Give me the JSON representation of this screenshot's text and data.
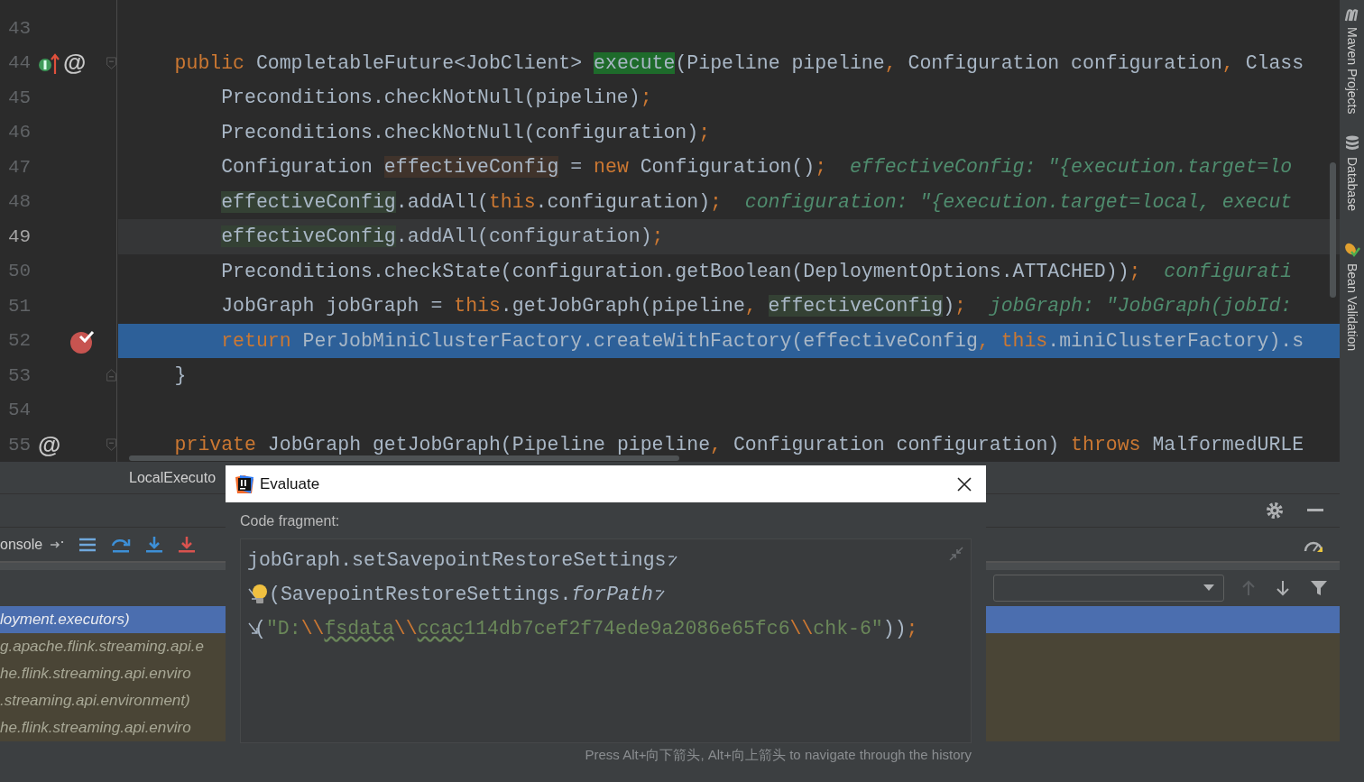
{
  "editor": {
    "lines": [
      {
        "number": "43",
        "caret_line": false,
        "execution_point": false
      },
      {
        "number": "44",
        "kind": "declaration",
        "caret_line": false,
        "execution_point": false,
        "marks": [
          {
            "kind": "implementing"
          },
          {
            "kind": "annotation",
            "text": "@"
          },
          {
            "kind": "fold-start"
          }
        ],
        "tokens": [
          {
            "text": "public",
            "kind": "keyword"
          },
          {
            "text": " CompletableFuture<JobClient> ",
            "kind": "plain"
          },
          {
            "text": "execute",
            "kind": "decl"
          },
          {
            "text": "(Pipeline pipeline",
            "kind": "plain"
          },
          {
            "text": ", ",
            "kind": "punct"
          },
          {
            "text": "Configuration configuration",
            "kind": "plain"
          },
          {
            "text": ", ",
            "kind": "punct"
          },
          {
            "text": "Class",
            "kind": "plain"
          }
        ]
      },
      {
        "number": "45",
        "kind": "statement",
        "caret_line": false,
        "execution_point": false,
        "tokens": [
          {
            "text": "Preconditions.checkNotNull(pipeline)",
            "kind": "plain"
          },
          {
            "text": ";",
            "kind": "punct"
          }
        ]
      },
      {
        "number": "46",
        "kind": "statement",
        "caret_line": false,
        "execution_point": false,
        "tokens": [
          {
            "text": "Preconditions.checkNotNull(configuration)",
            "kind": "plain"
          },
          {
            "text": ";",
            "kind": "punct"
          }
        ]
      },
      {
        "number": "47",
        "kind": "statement",
        "caret_line": false,
        "execution_point": false,
        "tokens": [
          {
            "text": "Configuration ",
            "kind": "plain"
          },
          {
            "text": "effectiveConfig",
            "kind": "write"
          },
          {
            "text": " = ",
            "kind": "plain"
          },
          {
            "text": "new",
            "kind": "keyword"
          },
          {
            "text": " Configuration()",
            "kind": "plain"
          },
          {
            "text": ";",
            "kind": "punct"
          },
          {
            "text": "  effectiveConfig: \"{execution.target=lo",
            "kind": "hint"
          }
        ]
      },
      {
        "number": "48",
        "kind": "statement",
        "caret_line": false,
        "execution_point": false,
        "tokens": [
          {
            "text": "effectiveConfig",
            "kind": "read"
          },
          {
            "text": ".addAll(",
            "kind": "plain"
          },
          {
            "text": "this",
            "kind": "keyword"
          },
          {
            "text": ".configuration)",
            "kind": "plain"
          },
          {
            "text": ";",
            "kind": "punct"
          },
          {
            "text": "  configuration: \"{execution.target=local, execut",
            "kind": "hint"
          }
        ]
      },
      {
        "number": "49",
        "kind": "statement",
        "caret_line": true,
        "execution_point": false,
        "tokens": [
          {
            "text": "effectiveConfig",
            "kind": "read"
          },
          {
            "text": ".addAll(configuration)",
            "kind": "plain"
          },
          {
            "text": ";",
            "kind": "punct"
          }
        ]
      },
      {
        "number": "50",
        "kind": "statement",
        "caret_line": false,
        "execution_point": false,
        "tokens": [
          {
            "text": "Preconditions.checkState(configuration.getBoolean(DeploymentOptions.ATTACHED))",
            "kind": "plain"
          },
          {
            "text": ";",
            "kind": "punct"
          },
          {
            "text": "  configurati",
            "kind": "hint"
          }
        ]
      },
      {
        "number": "51",
        "kind": "statement",
        "caret_line": false,
        "execution_point": false,
        "tokens": [
          {
            "text": "JobGraph jobGraph = ",
            "kind": "plain"
          },
          {
            "text": "this",
            "kind": "keyword"
          },
          {
            "text": ".getJobGraph(pipeline",
            "kind": "plain"
          },
          {
            "text": ", ",
            "kind": "punct"
          },
          {
            "text": "effectiveConfig",
            "kind": "read"
          },
          {
            "text": ")",
            "kind": "plain"
          },
          {
            "text": ";",
            "kind": "punct"
          },
          {
            "text": "  jobGraph: \"JobGraph(jobId:",
            "kind": "hint"
          }
        ]
      },
      {
        "number": "52",
        "kind": "statement",
        "caret_line": false,
        "execution_point": true,
        "marks": [
          {
            "kind": "breakpoint"
          }
        ],
        "tokens": [
          {
            "text": "return",
            "kind": "keyword"
          },
          {
            "text": " PerJobMiniClusterFactory.createWithFactory(effectiveConfig",
            "kind": "plain"
          },
          {
            "text": ", ",
            "kind": "punct"
          },
          {
            "text": "this",
            "kind": "keyword"
          },
          {
            "text": ".miniClusterFactory).s",
            "kind": "plain"
          }
        ]
      },
      {
        "number": "53",
        "kind": "closing",
        "caret_line": false,
        "execution_point": false,
        "marks": [
          {
            "kind": "fold-end"
          }
        ],
        "tokens": [
          {
            "text": "}",
            "kind": "plain"
          }
        ]
      },
      {
        "number": "54",
        "caret_line": false,
        "execution_point": false
      },
      {
        "number": "55",
        "kind": "declaration",
        "caret_line": false,
        "execution_point": false,
        "marks": [
          {
            "kind": "annotation",
            "text": "@"
          },
          {
            "kind": "fold-start"
          }
        ],
        "tokens": [
          {
            "text": "private",
            "kind": "keyword"
          },
          {
            "text": " JobGraph getJobGraph(Pipeline pipeline",
            "kind": "plain"
          },
          {
            "text": ", ",
            "kind": "punct"
          },
          {
            "text": "Configuration configuration) ",
            "kind": "plain"
          },
          {
            "text": "throws",
            "kind": "keyword"
          },
          {
            "text": " MalformedURLE",
            "kind": "plain"
          }
        ]
      }
    ]
  },
  "bottom_panel": {
    "tab": "LocalExecuto",
    "console_tab": "onsole",
    "frames": [
      {
        "text": "loyment.executors)",
        "selected": true
      },
      {
        "text": "g.apache.flink.streaming.api.e",
        "selected": false
      },
      {
        "text": "he.flink.streaming.api.enviro",
        "selected": false
      },
      {
        "text": ".streaming.api.environment)",
        "selected": false
      },
      {
        "text": "he.flink.streaming.api.enviro",
        "selected": false
      }
    ]
  },
  "dialog": {
    "title": "Evaluate",
    "label": "Code fragment:",
    "code_lines": [
      {
        "wrapped_from": false,
        "wraps": true,
        "bulb": false,
        "tokens": [
          {
            "text": "jobGraph.setSavepointRestoreSettings",
            "kind": "plain"
          }
        ]
      },
      {
        "wrapped_from": true,
        "wraps": true,
        "bulb": true,
        "tokens": [
          {
            "text": "(SavepointRestoreSettings.",
            "kind": "plain"
          },
          {
            "text": "forPath",
            "kind": "italic"
          }
        ]
      },
      {
        "wrapped_from": true,
        "wraps": false,
        "bulb": false,
        "tokens": [
          {
            "text": "(",
            "kind": "plain"
          },
          {
            "text": "\"D:",
            "kind": "string"
          },
          {
            "text": "\\\\",
            "kind": "escape"
          },
          {
            "text": "fsdata",
            "kind": "typo"
          },
          {
            "text": "\\\\",
            "kind": "escape"
          },
          {
            "text": "ccac",
            "kind": "typo"
          },
          {
            "text": "114db7cef2f74ede9a2086e65fc6",
            "kind": "string"
          },
          {
            "text": "\\\\",
            "kind": "escape"
          },
          {
            "text": "chk-6\"",
            "kind": "string"
          },
          {
            "text": "))",
            "kind": "plain"
          },
          {
            "text": ";",
            "kind": "punct"
          }
        ]
      }
    ],
    "hint": "Press Alt+向下箭头, Alt+向上箭头 to navigate through the history"
  },
  "right_sidebar": [
    {
      "kind": "maven",
      "label": "Maven Projects"
    },
    {
      "kind": "database",
      "label": "Database"
    },
    {
      "kind": "bean",
      "label": "Bean Validation"
    }
  ]
}
